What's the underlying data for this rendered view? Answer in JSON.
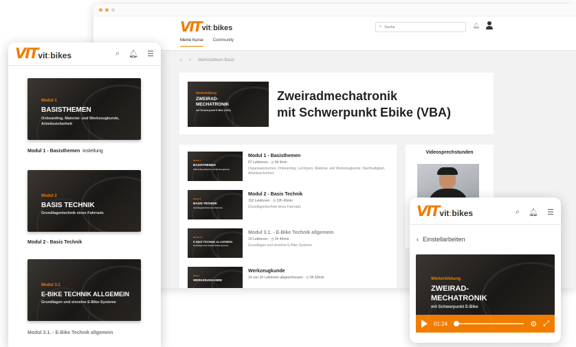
{
  "brand": {
    "logo_mark": "VIT",
    "logo_word_a": "vit",
    "logo_word_sep": ":",
    "logo_word_b": "bikes",
    "accent": "#f07d00"
  },
  "desktop": {
    "search_placeholder": "Suche",
    "nav": [
      "Meine Kurse",
      "Community"
    ],
    "breadcrumb": {
      "home_icon": "home-icon",
      "sep": ">",
      "current": "Werkstattkurs Basis"
    },
    "hero": {
      "title_line1": "Zweiradmechatronik",
      "title_line2": "mit Schwerpunkt Ebike (VBA)",
      "thumb": {
        "kicker": "Weiterbildung",
        "big1": "ZWEIRAD-",
        "big2": "MECHATRONIK",
        "sub": "mit Schwerpunkt E-Bike (VBA)"
      }
    },
    "modules": [
      {
        "title": "Modul 1 - Basisthemen",
        "meta": "87 Lektionen · ◷ 6h 6min",
        "desc": "Organisatorisches, Onboarding, Lerntypen, Material- und Werkzeugkunde, Nachhaltigkeit, Arbeitssicherheit",
        "thumb": {
          "kicker": "Modul 1",
          "big": "BASISTHEMEN",
          "sub": "Onboarding, Material- und Werkzeugkunde"
        }
      },
      {
        "title": "Modul 2 - Basis Technik",
        "meta": "192 Lektionen · ◷ 32h 45min",
        "desc": "Grundlagentechnik eines Fahrrads",
        "thumb": {
          "kicker": "Modul 2",
          "big": "BASIS TECHNIK",
          "sub": "Grundlagentechnik eines Fahrrads"
        }
      },
      {
        "title": "Modul 3.1. - E-Bike Technik allgemein",
        "meta": "10 Lektionen · ◷ 2h 46min",
        "desc": "Grundlagen und einzelne E-Bike Systeme",
        "thumb": {
          "kicker": "Modul 3.1",
          "big": "E-BIKE TECHNIK ALLGEMEIN",
          "sub": "Grundlagen und einzelne E-Bike-Systeme"
        }
      },
      {
        "title": "Werkzeugkunde",
        "meta": "14 von 24 Lektionen abgeschlossen · ◷ 9h 59min",
        "desc": "",
        "thumb": {
          "kicker": "Modul",
          "big": "WERKZEUGKUNDE",
          "sub": ""
        }
      }
    ],
    "video_title": "Videosprechstunden"
  },
  "phone_left": {
    "cards": [
      {
        "kicker": "Modul 1",
        "big": "BASISTHEMEN",
        "sub": "Onboarding, Material- und Werkzeugkunde, Arbeitssicherheit",
        "caption": "Modul 1 - Basisthemen",
        "caption_extra": "instellung"
      },
      {
        "kicker": "Modul 2",
        "big": "BASIS TECHNIK",
        "sub": "Grundlagentechnik eines Fahrrads",
        "caption": "Modul 2 - Basis Technik",
        "caption_extra": ""
      },
      {
        "kicker": "Modul 3.1",
        "big": "E-BIKE TECHNIK ALLGEMEIN",
        "sub": "Grundlagen und einzelne E-Bike-Systeme",
        "caption": "Modul 3.1. - E-Bike Technik allgemein",
        "caption_extra": ""
      }
    ]
  },
  "phone_right": {
    "back_label": "Einstellarbeiten",
    "video": {
      "kicker": "Weiterbildung",
      "big1": "ZWEIRAD-",
      "big2": "MECHATRONIK",
      "sub": "mit Schwerpunkt E-Bike"
    },
    "time": "01:24",
    "progress": 0
  },
  "icons": [
    "search-icon",
    "bell-icon",
    "menu-icon",
    "user-icon",
    "home-icon",
    "chevron-left-icon",
    "play-icon",
    "gear-icon",
    "fullscreen-icon"
  ]
}
